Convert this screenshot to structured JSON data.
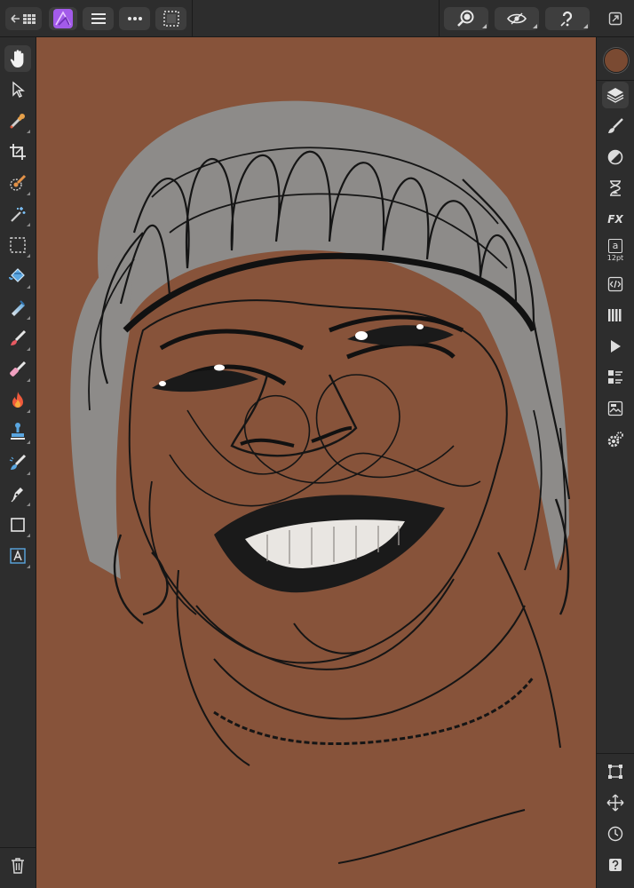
{
  "app": {
    "name": "Affinity Photo",
    "accent_color": "#9b59e0"
  },
  "topbar": {
    "back_button": {
      "icon": "back-to-gallery-icon"
    },
    "persona_button": {
      "icon": "affinity-photo-logo-icon"
    },
    "menu_button": {
      "icon": "hamburger-menu-icon"
    },
    "more_button": {
      "icon": "more-ellipsis-icon"
    },
    "selection_button": {
      "icon": "marquee-selection-icon"
    },
    "zoom_button": {
      "icon": "zoom-magnifier-icon"
    },
    "view_button": {
      "icon": "eye-view-icon"
    },
    "help_button": {
      "icon": "question-help-icon"
    },
    "fullscreen_button": {
      "icon": "fullscreen-toggle-icon"
    }
  },
  "left_tools": [
    {
      "name": "view-tool",
      "icon": "hand-icon",
      "active": true
    },
    {
      "name": "move-tool",
      "icon": "arrow-pointer-icon"
    },
    {
      "name": "color-picker-tool",
      "icon": "eyedropper-icon"
    },
    {
      "name": "crop-tool",
      "icon": "crop-icon"
    },
    {
      "name": "selection-brush-tool",
      "icon": "selection-brush-icon"
    },
    {
      "name": "flood-select-tool",
      "icon": "magic-wand-icon"
    },
    {
      "name": "marquee-tool",
      "icon": "marquee-icon"
    },
    {
      "name": "flood-fill-tool",
      "icon": "paint-bucket-icon"
    },
    {
      "name": "gradient-tool",
      "icon": "gradient-icon"
    },
    {
      "name": "paint-brush-tool",
      "icon": "paint-brush-icon"
    },
    {
      "name": "erase-brush-tool",
      "icon": "eraser-icon"
    },
    {
      "name": "dodge-burn-tool",
      "icon": "flame-icon"
    },
    {
      "name": "clone-tool",
      "icon": "clone-stamp-icon"
    },
    {
      "name": "retouch-tool",
      "icon": "retouch-brush-icon"
    },
    {
      "name": "pen-tool",
      "icon": "pen-nib-icon"
    },
    {
      "name": "shape-tool",
      "icon": "rectangle-icon"
    },
    {
      "name": "text-tool",
      "icon": "artistic-text-icon"
    }
  ],
  "right_studio": {
    "current_color": "#7a4a32",
    "text_size_label": "12pt",
    "fx_label": "FX",
    "text_glyph": "a",
    "items": [
      {
        "name": "layers-studio",
        "icon": "layers-icon",
        "active": true
      },
      {
        "name": "brushes-studio",
        "icon": "brush-icon"
      },
      {
        "name": "adjustments-studio",
        "icon": "adjustment-icon"
      },
      {
        "name": "history-studio",
        "icon": "hourglass-icon"
      },
      {
        "name": "effects-studio",
        "icon": "fx-icon"
      },
      {
        "name": "text-studio",
        "icon": "text-size-icon"
      },
      {
        "name": "macro-studio",
        "icon": "code-icon"
      },
      {
        "name": "channels-studio",
        "icon": "channels-icon"
      },
      {
        "name": "actions-studio",
        "icon": "play-icon"
      },
      {
        "name": "transform-studio",
        "icon": "transform-icon"
      },
      {
        "name": "navigator-studio",
        "icon": "navigator-icon"
      },
      {
        "name": "settings-studio",
        "icon": "settings-gear-icon"
      }
    ],
    "bottom_items": [
      {
        "name": "snapping-button",
        "icon": "snapping-grid-icon"
      },
      {
        "name": "transform-button",
        "icon": "move-arrows-icon"
      },
      {
        "name": "history-button",
        "icon": "clock-icon"
      },
      {
        "name": "help-button",
        "icon": "help-icon"
      }
    ]
  },
  "bottom_left": {
    "name": "delete-button",
    "icon": "trash-icon"
  },
  "canvas": {
    "background_color": "#87533a",
    "artwork": "scribble-portrait"
  }
}
